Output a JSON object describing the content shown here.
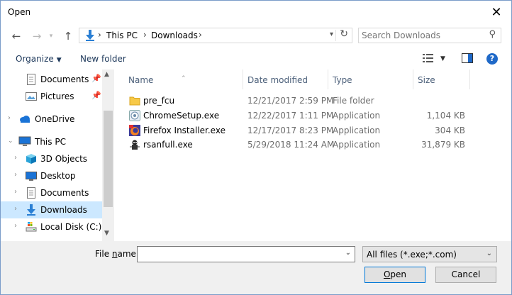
{
  "window": {
    "title": "Open",
    "close_glyph": "✕"
  },
  "nav": {
    "back": "←",
    "forward": "→",
    "up": "↑",
    "breadcrumb": [
      "This PC",
      "Downloads"
    ],
    "separator": "›",
    "refresh": "↻"
  },
  "search": {
    "placeholder": "Search Downloads",
    "icon": "search-icon"
  },
  "toolbar": {
    "organize": "Organize",
    "new_folder": "New folder",
    "help": "?"
  },
  "sidebar": {
    "items": [
      {
        "label": "Documents",
        "icon": "documents-icon",
        "pinned": true
      },
      {
        "label": "Pictures",
        "icon": "pictures-icon",
        "pinned": true
      },
      {
        "label": "OneDrive",
        "icon": "cloud-icon"
      },
      {
        "label": "This PC",
        "icon": "computer-icon"
      },
      {
        "label": "3D Objects",
        "icon": "cube-icon"
      },
      {
        "label": "Desktop",
        "icon": "desktop-icon"
      },
      {
        "label": "Documents",
        "icon": "documents-icon"
      },
      {
        "label": "Downloads",
        "icon": "download-icon",
        "selected": true
      },
      {
        "label": "Local Disk (C:)",
        "icon": "drive-icon"
      }
    ]
  },
  "columns": {
    "name": "Name",
    "date": "Date modified",
    "type": "Type",
    "size": "Size"
  },
  "files": [
    {
      "name": "pre_fcu",
      "date": "12/21/2017 2:59 PM",
      "type": "File folder",
      "size": "",
      "icon": "folder-icon"
    },
    {
      "name": "ChromeSetup.exe",
      "date": "12/22/2017 1:11 PM",
      "type": "Application",
      "size": "1,104 KB",
      "icon": "chrome-setup-icon"
    },
    {
      "name": "Firefox Installer.exe",
      "date": "12/17/2017 8:23 PM",
      "type": "Application",
      "size": "304 KB",
      "icon": "firefox-installer-icon"
    },
    {
      "name": "rsanfull.exe",
      "date": "5/29/2018 11:24 AM",
      "type": "Application",
      "size": "31,879 KB",
      "icon": "rsanfull-icon"
    }
  ],
  "bottom": {
    "filename_label_prefix": "File ",
    "filename_label_underlined": "n",
    "filename_label_suffix": "ame:",
    "filename_value": "",
    "filter": "All files (*.exe;*.com)",
    "open_underlined": "O",
    "open_rest": "pen",
    "cancel": "Cancel"
  },
  "colors": {
    "accent": "#0078d7",
    "selection": "#cce8ff",
    "folder": "#f7c948",
    "help": "#1f69c8"
  }
}
